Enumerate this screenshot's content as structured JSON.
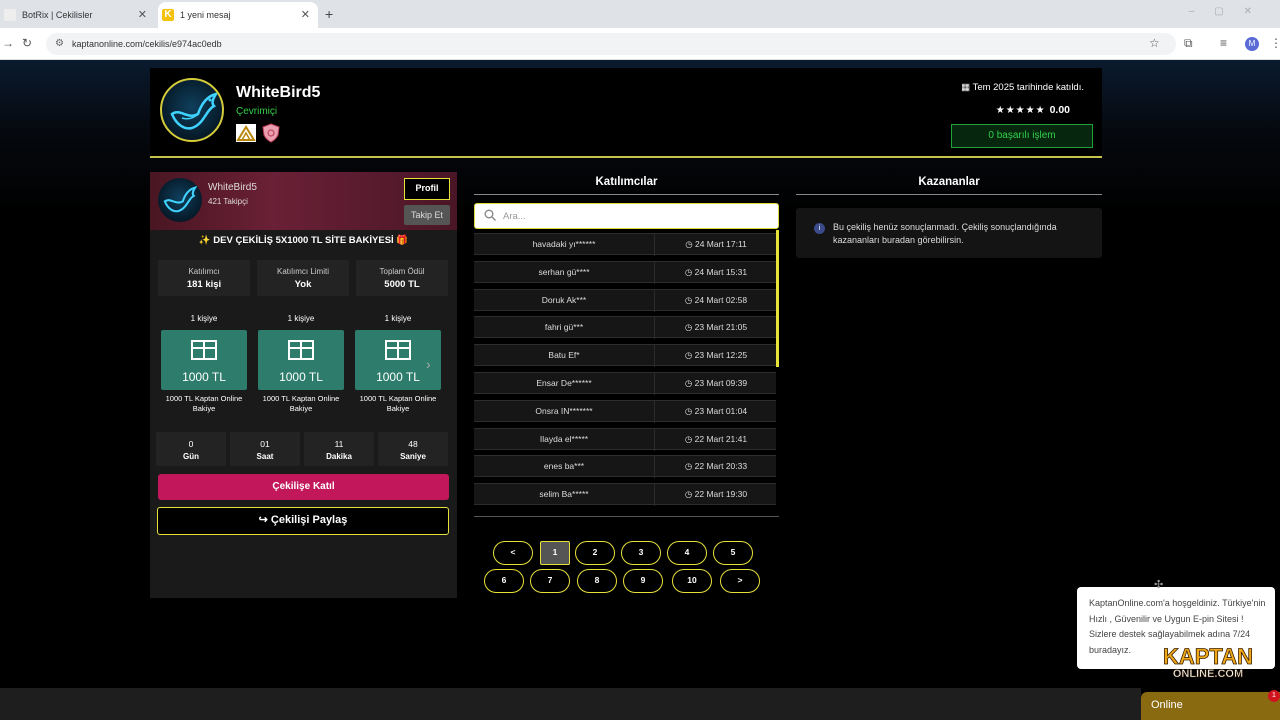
{
  "browser": {
    "tabs": [
      {
        "title": "BotRix | Cekilisler"
      },
      {
        "title": "1 yeni mesaj"
      }
    ],
    "url": "kaptanonline.com/cekilis/e974ac0edb",
    "profile_initial": "M",
    "new_tab": "+",
    "tab_close": "✕"
  },
  "owner": {
    "name": "WhiteBird5",
    "status": "Çevrimiçi",
    "joined": "Tem 2025 tarihinde katıldı.",
    "stars": "★★★★★",
    "rating": "0.00",
    "success": "0 başarılı işlem"
  },
  "panel": {
    "name": "WhiteBird5",
    "followers": "421 Takipçi",
    "profile_btn": "Profil",
    "follow_btn": "Takip Et",
    "event_title": "✨ DEV ÇEKİLİŞ 5X1000 TL SİTE BAKİYESİ 🎁",
    "stats": [
      {
        "label": "Katılımcı",
        "value": "181 kişi"
      },
      {
        "label": "Katılımcı Limiti",
        "value": "Yok"
      },
      {
        "label": "Toplam Ödül",
        "value": "5000 TL"
      }
    ],
    "prizes": [
      {
        "count": "1 kişiye",
        "amount": "1000 TL",
        "desc": "1000 TL Kaptan Online Bakiye"
      },
      {
        "count": "1 kişiye",
        "amount": "1000 TL",
        "desc": "1000 TL Kaptan Online Bakiye"
      },
      {
        "count": "1 kişiye",
        "amount": "1000 TL",
        "desc": "1000 TL Kaptan Online Bakiye"
      }
    ],
    "countdown": [
      {
        "n": "0",
        "u": "Gün"
      },
      {
        "n": "01",
        "u": "Saat"
      },
      {
        "n": "11",
        "u": "Dakika"
      },
      {
        "n": "48",
        "u": "Saniye"
      }
    ],
    "join_btn": "Çekilişe Katıl",
    "share_btn": "Çekilişi Paylaş"
  },
  "participants": {
    "heading": "Katılımcılar",
    "search_placeholder": "Ara...",
    "rows": [
      {
        "name": "havadaki yı******",
        "date": "24 Mart 17:11"
      },
      {
        "name": "serhan gü****",
        "date": "24 Mart 15:31"
      },
      {
        "name": "Doruk Ak***",
        "date": "24 Mart 02:58"
      },
      {
        "name": "fahri gü***",
        "date": "23 Mart 21:05"
      },
      {
        "name": "Batu Ef*",
        "date": "23 Mart 12:25"
      },
      {
        "name": "Ensar De******",
        "date": "23 Mart 09:39"
      },
      {
        "name": "Onsra IN*******",
        "date": "23 Mart 01:04"
      },
      {
        "name": "Ilayda el*****",
        "date": "22 Mart 21:41"
      },
      {
        "name": "enes ba***",
        "date": "22 Mart 20:33"
      },
      {
        "name": "selim Ba*****",
        "date": "22 Mart 19:30"
      }
    ],
    "pagination": [
      "<",
      "1",
      "2",
      "3",
      "4",
      "5",
      "6",
      "7",
      "8",
      "9",
      "10",
      ">"
    ],
    "current_page": "1"
  },
  "winners": {
    "heading": "Kazananlar",
    "info": "Bu çekiliş henüz sonuçlanmadı. Çekiliş sonuçlandığında kazananları buradan görebilirsin."
  },
  "chat": {
    "message": "KaptanOnline.com'a hoşgeldiniz. Türkiye'nin Hızlı , Güvenilir ve Uygun E-pin Sitesi ! Sizlere destek sağlayabilmek adına 7/24 buradayız.",
    "logo_top": "KAPTAN",
    "logo_bottom": "ONLINE.COM",
    "online": "Online",
    "unread": "1"
  },
  "colors": {
    "accent_yellow": "#e8e13a",
    "join_pink": "#c2185b",
    "online_green": "#35d14a",
    "prize_teal": "#2e7d6c"
  }
}
